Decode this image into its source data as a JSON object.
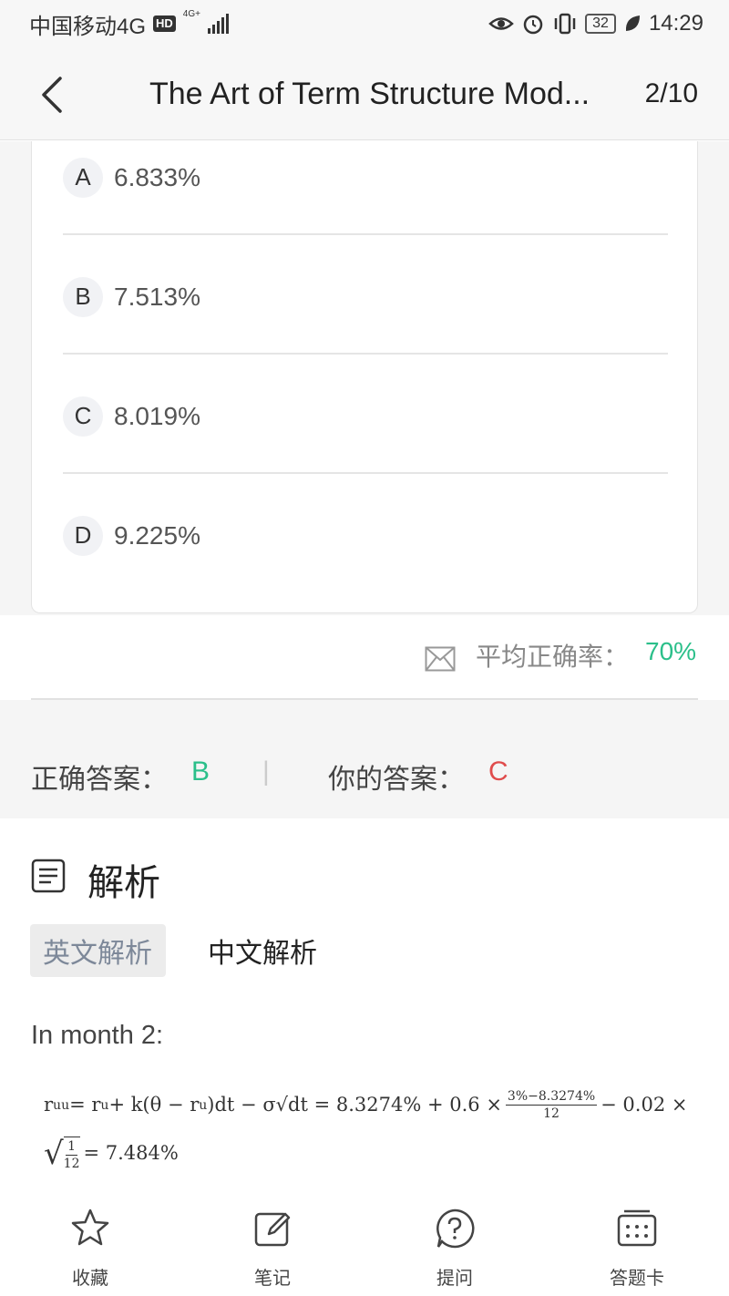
{
  "status_bar": {
    "carrier": "中国移动4G",
    "hd": "HD",
    "net": "4G+",
    "battery": "32",
    "time": "14:29"
  },
  "header": {
    "title": "The Art of Term Structure Mod...",
    "page": "2/10"
  },
  "options": [
    {
      "letter": "A",
      "value": "6.833%"
    },
    {
      "letter": "B",
      "value": "7.513%"
    },
    {
      "letter": "C",
      "value": "8.019%"
    },
    {
      "letter": "D",
      "value": "9.225%"
    }
  ],
  "stats": {
    "avg_label": "平均正确率：",
    "avg_value": "70%"
  },
  "answers": {
    "correct_label": "正确答案：",
    "correct_value": "B",
    "separator": "|",
    "yours_label": "你的答案：",
    "yours_value": "C"
  },
  "analysis": {
    "title": "解析",
    "tab_en": "英文解析",
    "tab_cn": "中文解析",
    "intro": "In month 2:",
    "formula_line1_a": "r",
    "formula_line1_sub1": "uu",
    "formula_line1_b": " = r",
    "formula_line1_sub2": "u",
    "formula_line1_c": " + k(θ − r",
    "formula_line1_sub3": "u",
    "formula_line1_d": ")dt − σ√dt = 8.3274% + 0.6 ×",
    "frac1_num": "3%−8.3274%",
    "frac1_den": "12",
    "formula_line1_e": "− 0.02 ×",
    "sqrt_num": "1",
    "sqrt_den": "12",
    "formula_line2_e": "= 7.484%"
  },
  "bottom_bar": {
    "favorite": "收藏",
    "notes": "笔记",
    "ask": "提问",
    "answer_card": "答题卡"
  },
  "colors": {
    "correct": "#2bbf8a",
    "wrong": "#e04c4c",
    "tab_active_bg": "#ececec"
  }
}
